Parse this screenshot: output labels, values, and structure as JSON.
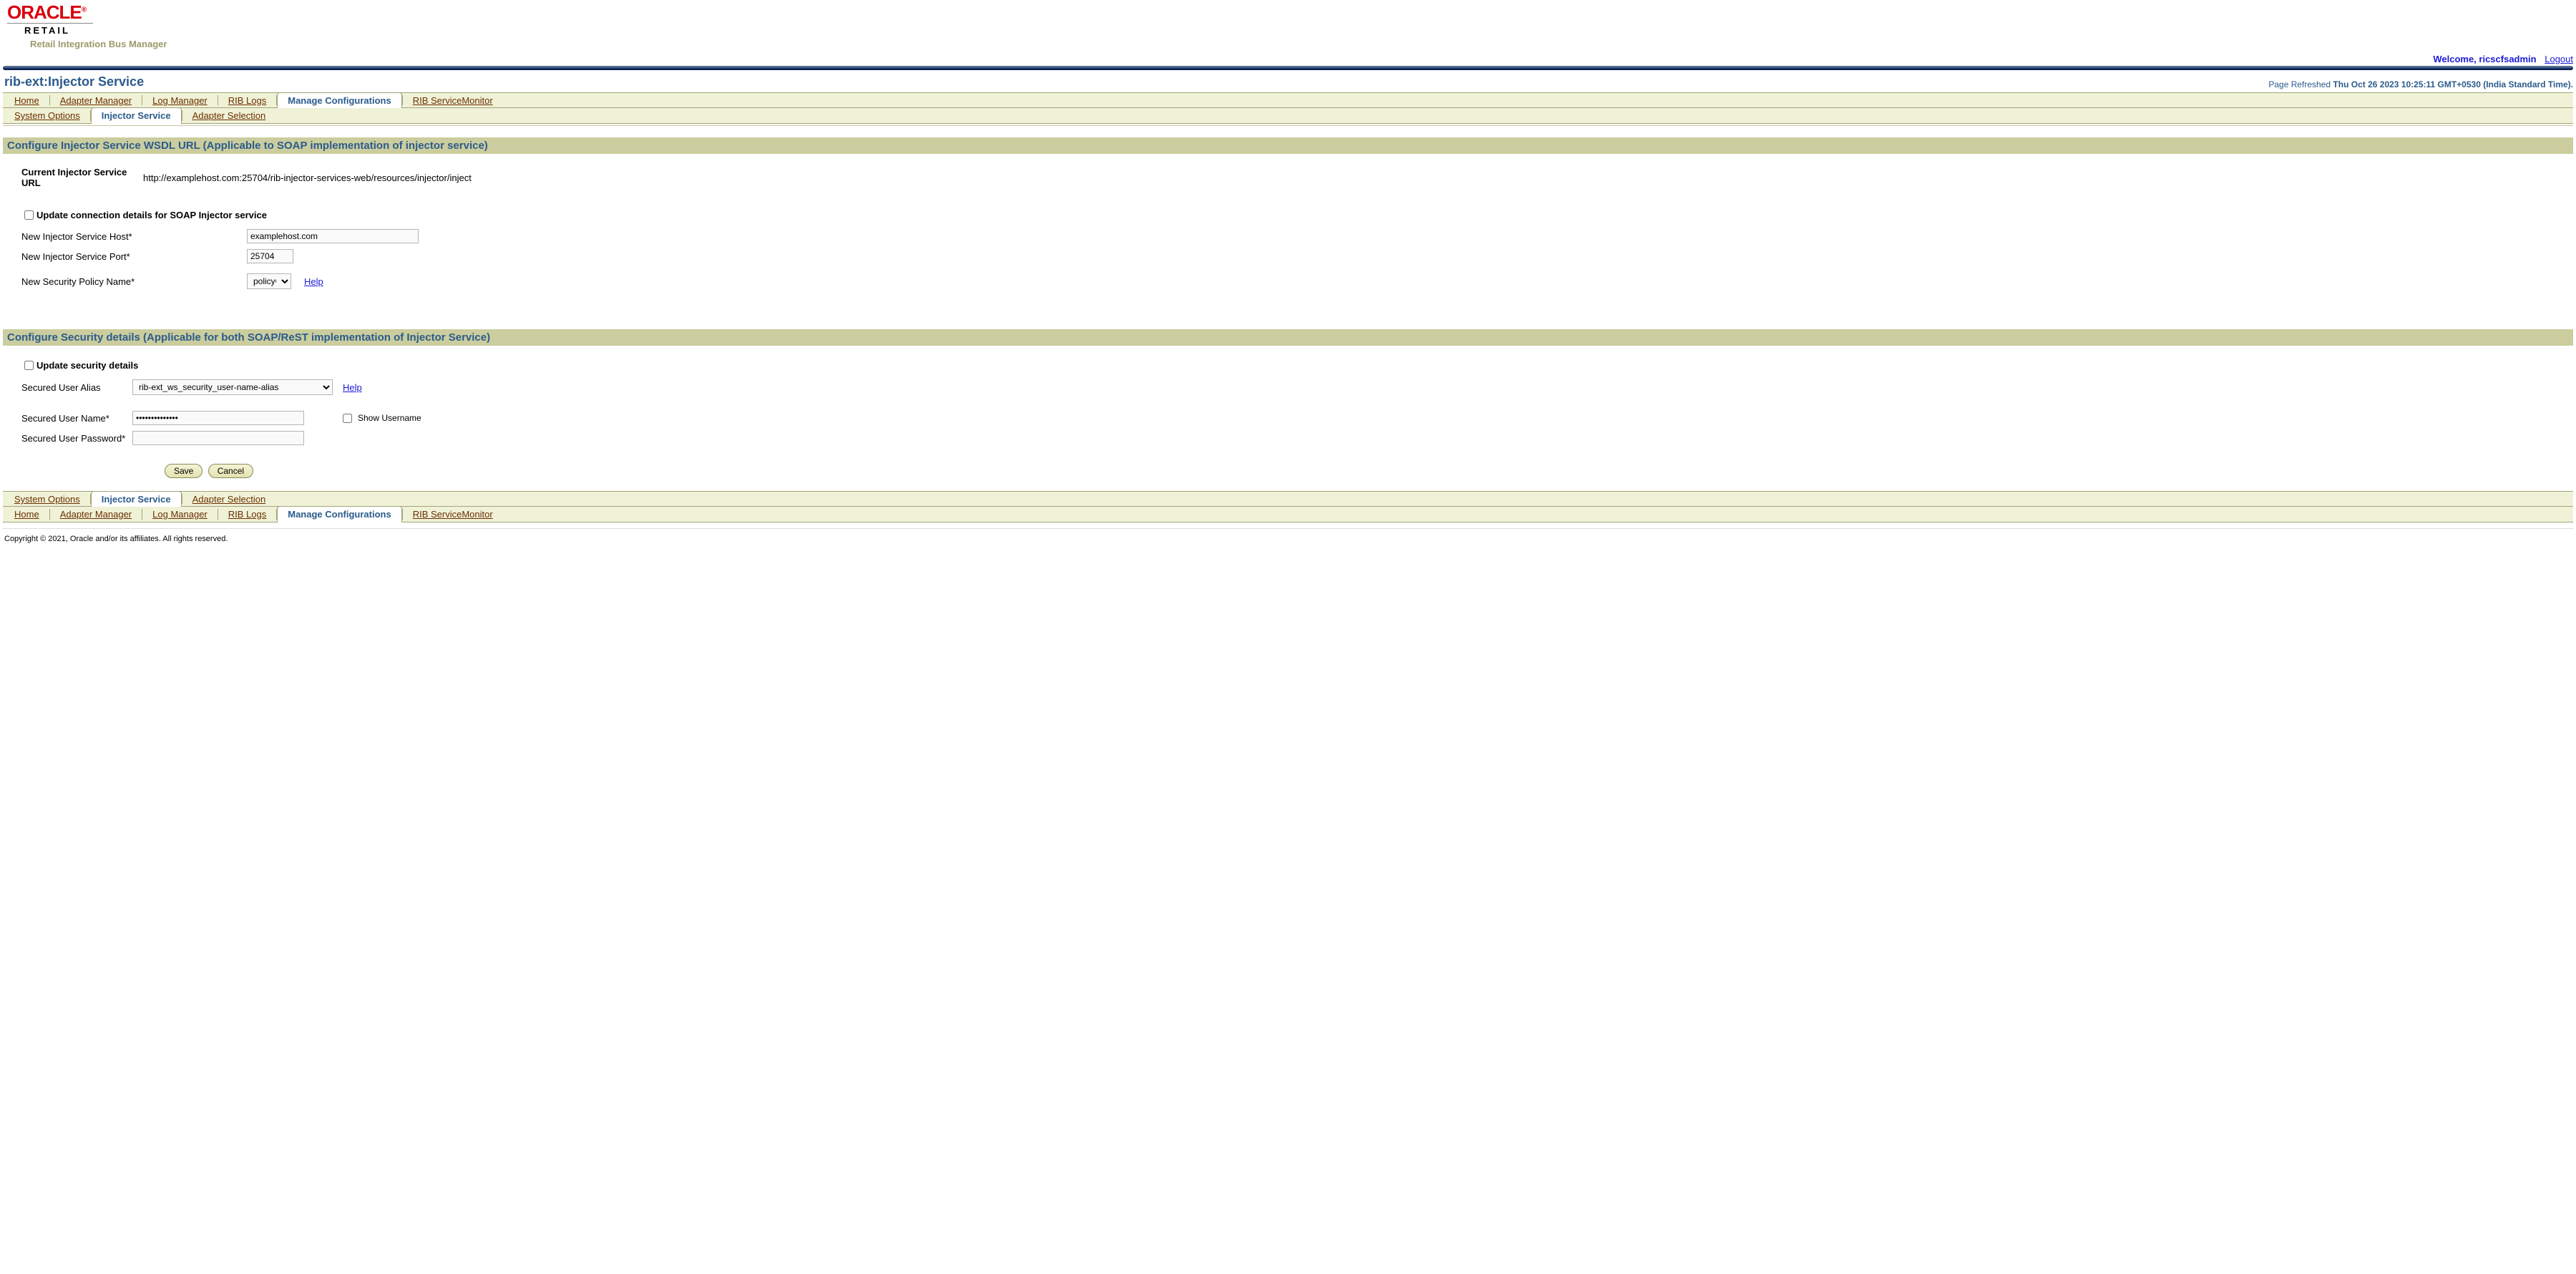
{
  "header": {
    "brand_upper": "ORACLE",
    "brand_mark": "®",
    "brand_lower": "RETAIL",
    "subtitle": "Retail Integration Bus Manager",
    "welcome": "Welcome, ricscfsadmin",
    "logout": "Logout"
  },
  "page": {
    "title": "rib-ext:Injector Service",
    "refreshed_label": "Page Refreshed",
    "refreshed_value": "Thu Oct 26 2023 10:25:11 GMT+0530 (India Standard Time)."
  },
  "tabs_main": {
    "home": "Home",
    "adapter_manager": "Adapter Manager",
    "log_manager": "Log Manager",
    "rib_logs": "RIB Logs",
    "manage_configurations": "Manage Configurations",
    "rib_servicemonitor": "RIB ServiceMonitor"
  },
  "tabs_sub": {
    "system_options": "System Options",
    "injector_service": "Injector Service",
    "adapter_selection": "Adapter Selection"
  },
  "section1": {
    "heading": "Configure Injector Service WSDL URL (Applicable to SOAP implementation of injector service)",
    "current_url_label": "Current Injector Service URL",
    "current_url_value": "http://examplehost.com:25704/rib-injector-services-web/resources/injector/inject",
    "update_checkbox": "Update connection details for SOAP Injector service",
    "host_label": "New Injector Service Host*",
    "host_value": "examplehost.com",
    "port_label": "New Injector Service Port*",
    "port_value": "25704",
    "policy_label": "New Security Policy Name*",
    "policy_value": "policyC",
    "help": "Help"
  },
  "section2": {
    "heading": "Configure Security details (Applicable for both SOAP/ReST implementation of Injector Service)",
    "update_checkbox": "Update security details",
    "alias_label": "Secured User Alias",
    "alias_value": "rib-ext_ws_security_user-name-alias",
    "help": "Help",
    "username_label": "Secured User Name*",
    "username_value": "••••••••••••••",
    "show_username": "Show Username",
    "password_label": "Secured User Password*",
    "password_value": ""
  },
  "buttons": {
    "save": "Save",
    "cancel": "Cancel"
  },
  "footer": {
    "copyright": "Copyright © 2021, Oracle and/or its affiliates. All rights reserved."
  }
}
